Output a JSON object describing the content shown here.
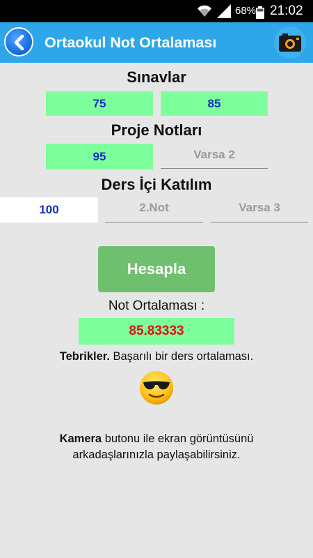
{
  "status_bar": {
    "battery_percent": "68%",
    "time": "21:02",
    "icons": [
      "wifi-icon",
      "signal-icon",
      "battery-icon"
    ]
  },
  "app_bar": {
    "title": "Ortaokul Not Ortalaması",
    "back_icon": "back-arrow-icon",
    "camera_icon": "camera-icon",
    "accent_color": "#2ea7ea"
  },
  "exams": {
    "title": "Sınavlar",
    "fields": [
      {
        "value": "75",
        "placeholder": ""
      },
      {
        "value": "85",
        "placeholder": ""
      }
    ]
  },
  "projects": {
    "title": "Proje Notları",
    "fields": [
      {
        "value": "95",
        "placeholder": ""
      },
      {
        "value": "",
        "placeholder": "Varsa 2"
      }
    ]
  },
  "participation": {
    "title": "Ders İçi Katılım",
    "fields": [
      {
        "value": "100",
        "placeholder": ""
      },
      {
        "value": "",
        "placeholder": "2.Not"
      },
      {
        "value": "",
        "placeholder": "Varsa  3"
      }
    ]
  },
  "calculate_button": "Hesapla",
  "result": {
    "label": "Not Ortalaması :",
    "value": "85.83333",
    "value_color": "#e01010"
  },
  "message": {
    "bold": "Tebrikler.",
    "text": " Başarılı bir ders ortalaması.",
    "emoji": "sunglasses-smiley-icon"
  },
  "footer": {
    "bold": "Kamera",
    "line1": " butonu ile ekran görüntüsünü",
    "line2": "arkadaşlarınızla paylaşabilirsiniz."
  }
}
